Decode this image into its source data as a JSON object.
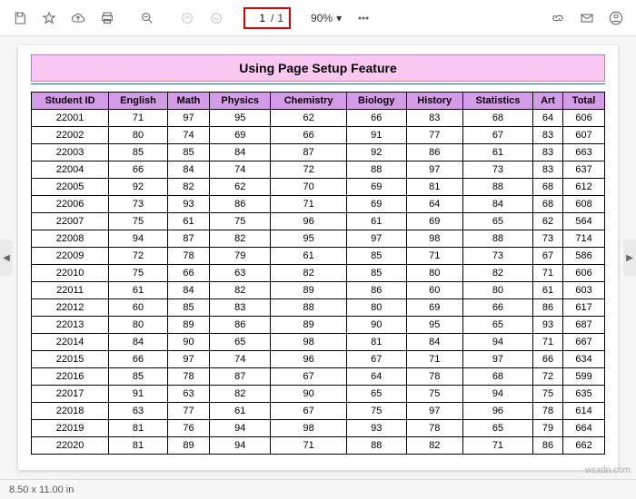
{
  "toolbar": {
    "page_current": "1",
    "page_sep": "/",
    "page_total": "1",
    "zoom": "90%"
  },
  "document": {
    "title": "Using Page Setup Feature",
    "columns": [
      "Student ID",
      "English",
      "Math",
      "Physics",
      "Chemistry",
      "Biology",
      "History",
      "Statistics",
      "Art",
      "Total"
    ],
    "rows": [
      [
        "22001",
        "71",
        "97",
        "95",
        "62",
        "66",
        "83",
        "68",
        "64",
        "606"
      ],
      [
        "22002",
        "80",
        "74",
        "69",
        "66",
        "91",
        "77",
        "67",
        "83",
        "607"
      ],
      [
        "22003",
        "85",
        "85",
        "84",
        "87",
        "92",
        "86",
        "61",
        "83",
        "663"
      ],
      [
        "22004",
        "66",
        "84",
        "74",
        "72",
        "88",
        "97",
        "73",
        "83",
        "637"
      ],
      [
        "22005",
        "92",
        "82",
        "62",
        "70",
        "69",
        "81",
        "88",
        "68",
        "612"
      ],
      [
        "22006",
        "73",
        "93",
        "86",
        "71",
        "69",
        "64",
        "84",
        "68",
        "608"
      ],
      [
        "22007",
        "75",
        "61",
        "75",
        "96",
        "61",
        "69",
        "65",
        "62",
        "564"
      ],
      [
        "22008",
        "94",
        "87",
        "82",
        "95",
        "97",
        "98",
        "88",
        "73",
        "714"
      ],
      [
        "22009",
        "72",
        "78",
        "79",
        "61",
        "85",
        "71",
        "73",
        "67",
        "586"
      ],
      [
        "22010",
        "75",
        "66",
        "63",
        "82",
        "85",
        "80",
        "82",
        "71",
        "606"
      ],
      [
        "22011",
        "61",
        "84",
        "82",
        "89",
        "86",
        "60",
        "80",
        "61",
        "603"
      ],
      [
        "22012",
        "60",
        "85",
        "83",
        "88",
        "80",
        "69",
        "66",
        "86",
        "617"
      ],
      [
        "22013",
        "80",
        "89",
        "86",
        "89",
        "90",
        "95",
        "65",
        "93",
        "687"
      ],
      [
        "22014",
        "84",
        "90",
        "65",
        "98",
        "81",
        "84",
        "94",
        "71",
        "667"
      ],
      [
        "22015",
        "66",
        "97",
        "74",
        "96",
        "67",
        "71",
        "97",
        "66",
        "634"
      ],
      [
        "22016",
        "85",
        "78",
        "87",
        "67",
        "64",
        "78",
        "68",
        "72",
        "599"
      ],
      [
        "22017",
        "91",
        "63",
        "82",
        "90",
        "65",
        "75",
        "94",
        "75",
        "635"
      ],
      [
        "22018",
        "63",
        "77",
        "61",
        "67",
        "75",
        "97",
        "96",
        "78",
        "614"
      ],
      [
        "22019",
        "81",
        "76",
        "94",
        "98",
        "93",
        "78",
        "65",
        "79",
        "664"
      ],
      [
        "22020",
        "81",
        "89",
        "94",
        "71",
        "88",
        "82",
        "71",
        "86",
        "662"
      ]
    ]
  },
  "status": {
    "dimensions": "8.50 x 11.00 in"
  },
  "watermark": "wsxdn.com"
}
